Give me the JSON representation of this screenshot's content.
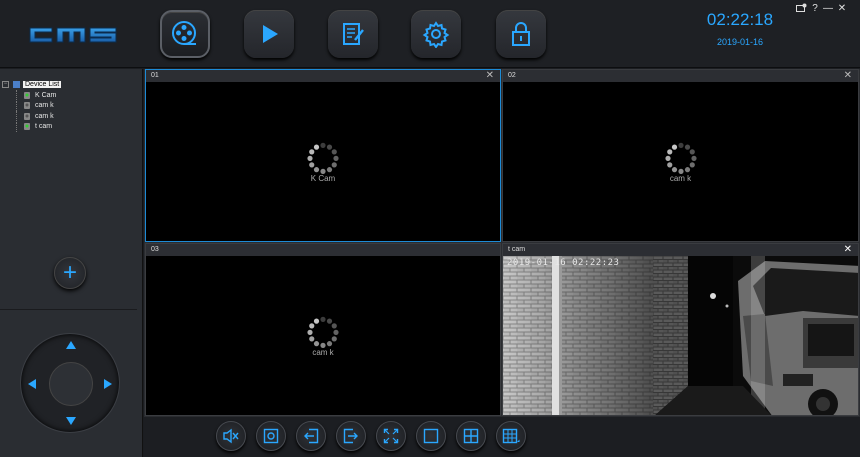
{
  "app": {
    "logo_text": "CMS"
  },
  "nav": [
    {
      "id": "live-view",
      "icon": "film-reel-icon",
      "active": true
    },
    {
      "id": "playback",
      "icon": "play-icon",
      "active": false
    },
    {
      "id": "log",
      "icon": "edit-document-icon",
      "active": false
    },
    {
      "id": "settings",
      "icon": "gear-icon",
      "active": false
    },
    {
      "id": "lock",
      "icon": "lock-icon",
      "active": false
    }
  ],
  "header": {
    "time": "02:22:18",
    "date": "2019-01-16"
  },
  "window_controls": [
    "camera-settings-icon",
    "help-icon",
    "minimize-icon",
    "close-icon"
  ],
  "device_tree": {
    "root_label": "Device List",
    "items": [
      {
        "label": "K        Cam",
        "status": "online-green"
      },
      {
        "label": "cam k",
        "status": "offline"
      },
      {
        "label": "cam k",
        "status": "offline"
      },
      {
        "label": "t          cam",
        "status": "online-green"
      }
    ]
  },
  "panes": [
    {
      "title": "01",
      "caption": "K      Cam",
      "state": "loading",
      "selected": true
    },
    {
      "title": "02",
      "caption": "cam k",
      "state": "loading",
      "selected": false
    },
    {
      "title": "03",
      "caption": "cam k",
      "state": "loading",
      "selected": false
    },
    {
      "title": "t        cam",
      "caption": "",
      "state": "playing",
      "selected": false,
      "osd": "2019-01-16  02:22:23"
    }
  ],
  "toolbar": [
    "mute-icon",
    "snapshot-icon",
    "record-import-icon",
    "export-icon",
    "fullscreen-icon",
    "single-layout-icon",
    "quad-layout-icon",
    "multi-layout-icon"
  ],
  "colors": {
    "accent": "#2aa7ff",
    "selected_border": "#1d8bd6",
    "background": "#1b1d21"
  }
}
